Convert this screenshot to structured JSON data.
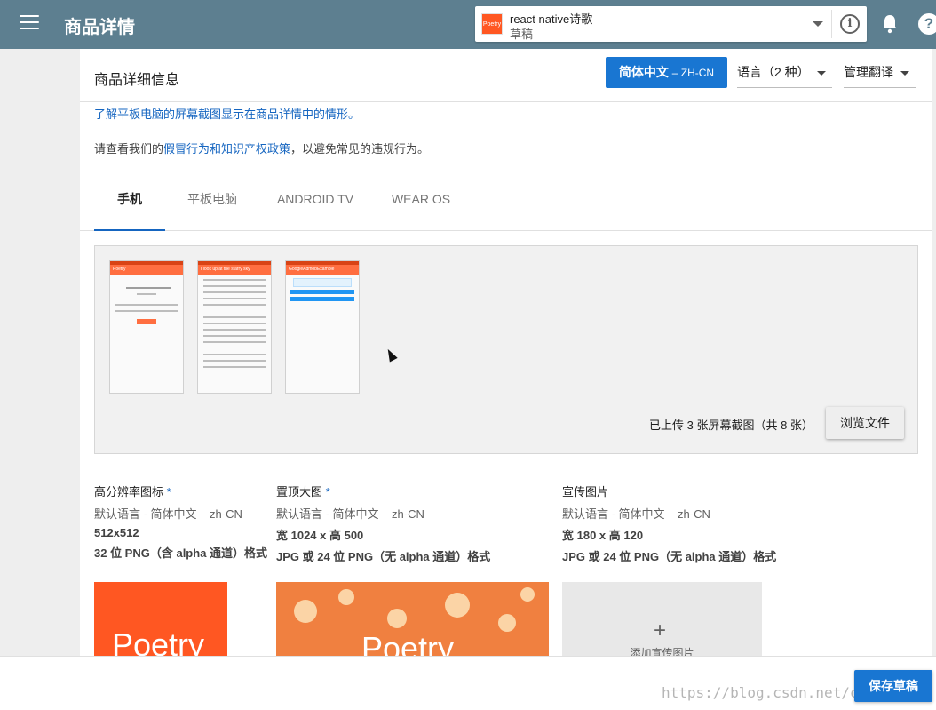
{
  "topbar": {
    "title": "商品详情",
    "app_name": "react native诗歌",
    "app_status": "草稿",
    "app_icon_text": "Poetry"
  },
  "header": {
    "title": "商品详细信息",
    "lang_primary": "简体中文",
    "lang_code": "– ZH-CN",
    "lang_dropdown": "语言（2 种）",
    "translate_dropdown": "管理翻译"
  },
  "info": {
    "tablet_link": "了解平板电脑的屏幕截图显示在商品详情中的情形。",
    "policy_prefix": "请查看我们的",
    "policy_link": "假冒行为和知识产权政策",
    "policy_suffix": "，以避免常见的违规行为。"
  },
  "tabs": [
    {
      "label": "手机",
      "active": true
    },
    {
      "label": "平板电脑",
      "active": false
    },
    {
      "label": "ANDROID TV",
      "active": false
    },
    {
      "label": "WEAR OS",
      "active": false
    }
  ],
  "screenshots": {
    "upload_status": "已上传 3 张屏幕截图（共 8 张）",
    "browse_label": "浏览文件",
    "thumbs": [
      {
        "appbar": "Poetry"
      },
      {
        "appbar": "I look up at the starry sky"
      },
      {
        "appbar": "GoogleAdmobExample"
      }
    ]
  },
  "graphics": [
    {
      "heading": "高分辨率图标",
      "required": "*",
      "meta": "默认语言 - 简体中文 – zh-CN",
      "size": "512x512",
      "format": "32 位 PNG（含 alpha 通道）格式"
    },
    {
      "heading": "置顶大图",
      "required": "*",
      "meta": "默认语言 - 简体中文 – zh-CN",
      "size": "宽 1024 x 高 500",
      "format": "JPG 或 24 位 PNG（无 alpha 通道）格式"
    },
    {
      "heading": "宣传图片",
      "required": "",
      "meta": "默认语言 - 简体中文 – zh-CN",
      "size": "宽 180 x 高 120",
      "format": "JPG 或 24 位 PNG（无 alpha 通道）格式"
    }
  ],
  "previews": {
    "icon_text": "Poetry",
    "feature_text": "Poetry",
    "promo_plus": "+",
    "promo_add_label": "添加宣传图片"
  },
  "footer": {
    "save_label": "保存草稿",
    "watermark": "https://blog.csdn.net/chensenp"
  },
  "colors": {
    "topbar": "#5d7f90",
    "primary": "#1976d2",
    "accent_orange": "#ff5722"
  }
}
